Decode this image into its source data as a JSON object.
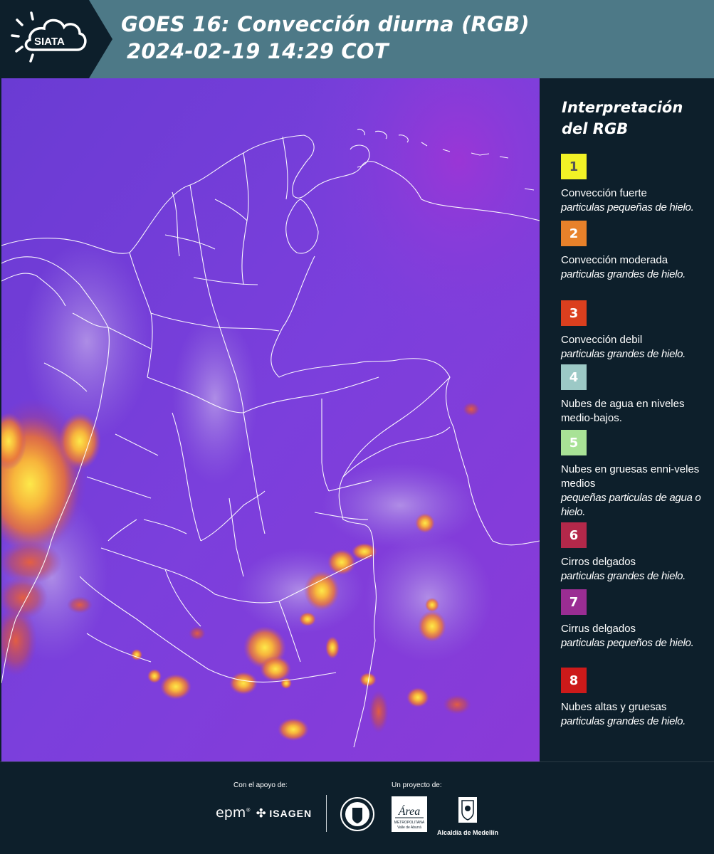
{
  "header": {
    "logo_text": "SIATA",
    "title_line1": "GOES 16: Convección diurna (RGB)",
    "title_line2": "2024-02-19 14:29 COT"
  },
  "legend": {
    "title": "Interpretación del RGB",
    "items": [
      {
        "number": "1",
        "color": "#f2f226",
        "number_color": "#555555",
        "label": "Convección fuerte",
        "sub": "particulas pequeñas de hielo."
      },
      {
        "number": "2",
        "color": "#e8812a",
        "number_color": "#ffffff",
        "label": "Convección moderada",
        "sub": "particulas grandes de hielo."
      },
      {
        "number": "3",
        "color": "#db3f1e",
        "number_color": "#ffffff",
        "label": "Convección debil",
        "sub": "particulas grandes de hielo."
      },
      {
        "number": "4",
        "color": "#9cc9c6",
        "number_color": "#ffffff",
        "label": "Nubes de agua en niveles medio-bajos.",
        "sub": ""
      },
      {
        "number": "5",
        "color": "#a8e296",
        "number_color": "#ffffff",
        "label": "Nubes en gruesas enni-veles medios",
        "sub": "pequeñas particulas de agua o hielo."
      },
      {
        "number": "6",
        "color": "#b3284a",
        "number_color": "#ffffff",
        "label": "Cirros delgados",
        "sub": "particulas grandes de hielo."
      },
      {
        "number": "7",
        "color": "#9a2d93",
        "number_color": "#ffffff",
        "label": "Cirrus delgados",
        "sub": "particulas pequeños de hielo."
      },
      {
        "number": "8",
        "color": "#cc1a1a",
        "number_color": "#ffffff",
        "label": "Nubes altas y gruesas",
        "sub": "particulas grandes de hielo."
      }
    ]
  },
  "footer": {
    "support_label": "Con el apoyo de:",
    "project_label": "Un proyecto de:",
    "sponsors": [
      "epm",
      "ISAGEN"
    ],
    "partners": [
      "Área Metropolitana Valle de Aburrá",
      "Alcaldía de Medellín"
    ],
    "alcaldia_text": "Alcaldía de Medellín"
  },
  "colors": {
    "header_bg": "#4d7987",
    "panel_bg": "#0d1f2b",
    "map_base": "#7a3ad6"
  }
}
